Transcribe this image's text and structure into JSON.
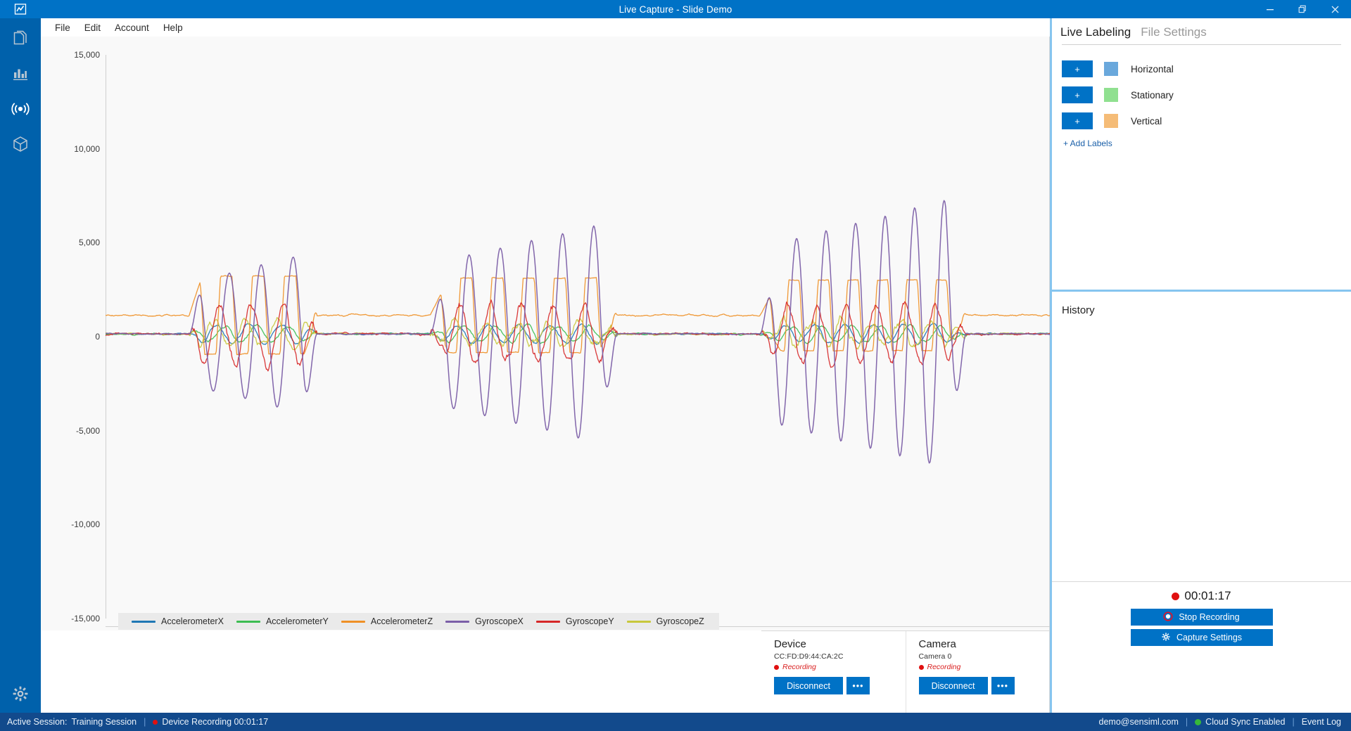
{
  "window": {
    "title": "Live Capture - Slide Demo",
    "minimize_label": "–",
    "restore_label": "❐",
    "close_label": "✕"
  },
  "menu": {
    "items": [
      "File",
      "Edit",
      "Account",
      "Help"
    ]
  },
  "sidebar": {
    "items": [
      {
        "name": "documents",
        "icon": "documents-icon",
        "active": false
      },
      {
        "name": "charts",
        "icon": "bar-chart-icon",
        "active": false
      },
      {
        "name": "live-capture",
        "icon": "live-broadcast-icon",
        "active": true
      },
      {
        "name": "models",
        "icon": "cube-icon",
        "active": false
      }
    ],
    "settings": {
      "name": "settings",
      "icon": "gear-icon"
    }
  },
  "right_panel": {
    "tabs": [
      {
        "label": "Live Labeling",
        "active": true
      },
      {
        "label": "File Settings",
        "active": false
      }
    ],
    "labels": [
      {
        "add_label": "+",
        "color": "#6aa8dc",
        "name": "Horizontal"
      },
      {
        "add_label": "+",
        "color": "#90e090",
        "name": "Stationary"
      },
      {
        "add_label": "+",
        "color": "#f5bc77",
        "name": "Vertical"
      }
    ],
    "add_labels_link": "+ Add Labels",
    "history_title": "History",
    "recording": {
      "timer": "00:01:17",
      "stop_label": "Stop Recording",
      "settings_label": "Capture Settings"
    }
  },
  "devices": [
    {
      "title": "Device",
      "subtitle": "CC:FD:D9:44:CA:2C",
      "status": "Recording",
      "disconnect_label": "Disconnect",
      "more_label": "•••"
    },
    {
      "title": "Camera",
      "subtitle": "Camera 0",
      "status": "Recording",
      "disconnect_label": "Disconnect",
      "more_label": "•••"
    }
  ],
  "statusbar": {
    "session_label": "Active Session:",
    "session_name": "Training Session",
    "device_recording": "Device Recording 00:01:17",
    "account": "demo@sensiml.com",
    "cloud_sync": "Cloud Sync Enabled",
    "event_log": "Event Log"
  },
  "chart_data": {
    "type": "line",
    "title": "",
    "xlabel": "",
    "ylabel": "",
    "ylim": [
      -15000,
      15000
    ],
    "yticks": [
      15000,
      10000,
      5000,
      0,
      -5000,
      -10000,
      -15000
    ],
    "ytick_labels": [
      "15,000",
      "10,000",
      "5,000",
      "0",
      "-5,000",
      "-10,000",
      "-15,000"
    ],
    "grid": false,
    "legend_position": "bottom-left",
    "series": [
      {
        "name": "AccelerometerX",
        "color": "#1f77b4"
      },
      {
        "name": "AccelerometerY",
        "color": "#3dbd52"
      },
      {
        "name": "AccelerometerZ",
        "color": "#ef9026"
      },
      {
        "name": "GyroscopeX",
        "color": "#7b5ea7"
      },
      {
        "name": "GyroscopeY",
        "color": "#d62728"
      },
      {
        "name": "GyroscopeZ",
        "color": "#c8c83c"
      }
    ],
    "bursts": [
      {
        "start": 0.085,
        "end": 0.215,
        "cycles": 4,
        "gyro_x_amp": 3800,
        "accel_z_amp": 2100,
        "gyro_y_amp": 1700
      },
      {
        "start": 0.33,
        "end": 0.52,
        "cycles": 6,
        "gyro_x_amp": 5200,
        "accel_z_amp": 2000,
        "gyro_y_amp": 1500
      },
      {
        "start": 0.665,
        "end": 0.875,
        "cycles": 7,
        "gyro_x_amp": 6400,
        "accel_z_amp": 1900,
        "gyro_y_amp": 1600
      }
    ],
    "baseline": {
      "accel_z_offset": 1000,
      "noise_amp": 160
    }
  }
}
